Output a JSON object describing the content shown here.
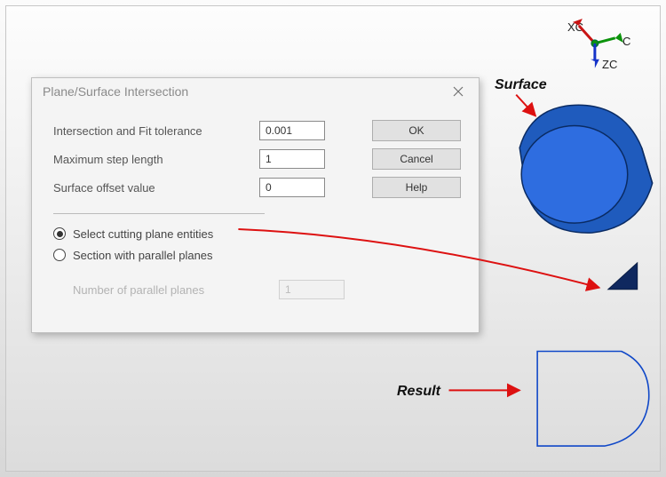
{
  "dialog": {
    "title": "Plane/Surface Intersection",
    "fields": {
      "tolerance_label": "Intersection and Fit tolerance",
      "tolerance_value": "0.001",
      "step_label": "Maximum step length",
      "step_value": "1",
      "offset_label": "Surface offset value",
      "offset_value": "0"
    },
    "buttons": {
      "ok": "OK",
      "cancel": "Cancel",
      "help": "Help"
    },
    "options": {
      "select_cutting": "Select cutting plane entities",
      "section_parallel": "Section with parallel planes",
      "num_planes_label": "Number of parallel planes",
      "num_planes_value": "1"
    }
  },
  "annotations": {
    "surface": "Surface",
    "result": "Result"
  },
  "axes": {
    "x": "XC",
    "y": "C",
    "z": "ZC"
  }
}
